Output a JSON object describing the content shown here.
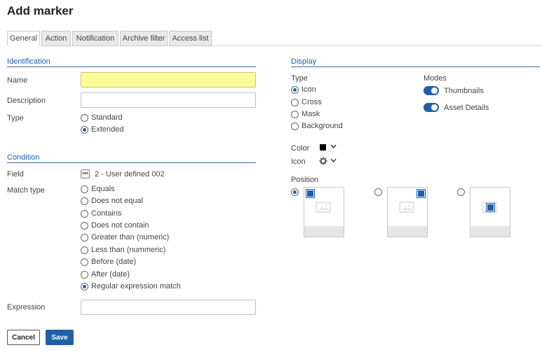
{
  "page": {
    "title": "Add marker"
  },
  "tabs": [
    "General",
    "Action",
    "Notification",
    "Archive filter",
    "Access list"
  ],
  "identification": {
    "heading": "Identification",
    "name_label": "Name",
    "name_value": "",
    "description_label": "Description",
    "description_value": "",
    "type_label": "Type",
    "type_options": [
      "Standard",
      "Extended"
    ],
    "type_selected": "Extended"
  },
  "condition": {
    "heading": "Condition",
    "field_label": "Field",
    "field_button": "•••",
    "field_value": "2 - User defined 002",
    "match_type_label": "Match type",
    "match_options": [
      "Equals",
      "Does not equal",
      "Contains",
      "Does not contain",
      "Greater than (numeric)",
      "Less than (nummeric)",
      "Before (date)",
      "After (date)",
      "Regular expression match"
    ],
    "match_selected": "Regular expression match",
    "expression_label": "Expression",
    "expression_value": ""
  },
  "display": {
    "heading": "Display",
    "type_label": "Type",
    "type_options": [
      "Icon",
      "Cross",
      "Mask",
      "Background"
    ],
    "type_selected": "Icon",
    "modes_label": "Modes",
    "modes": [
      {
        "label": "Thumbnails",
        "enabled": true
      },
      {
        "label": "Asset Details",
        "enabled": true
      }
    ],
    "color_label": "Color",
    "color_value": "#000000",
    "icon_label": "Icon",
    "icon_value": "gear-icon",
    "position_label": "Position",
    "positions": [
      "top-left",
      "top-right",
      "center"
    ],
    "position_selected": "top-left"
  },
  "buttons": {
    "cancel": "Cancel",
    "save": "Save"
  },
  "colors": {
    "accent": "#1e5fa8",
    "highlight": "#fbfb9a"
  }
}
